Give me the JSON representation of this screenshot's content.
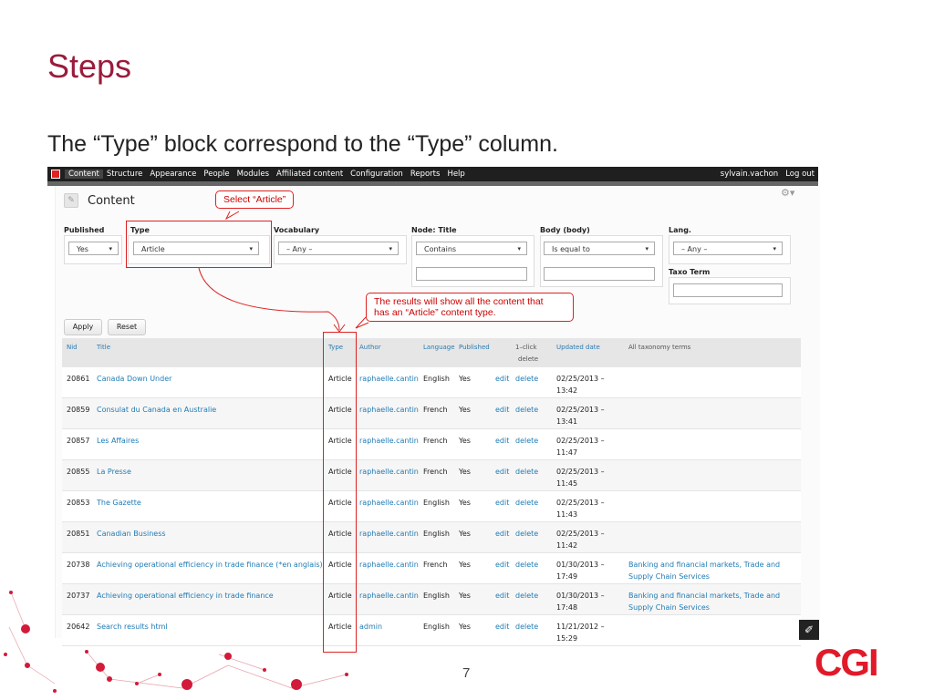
{
  "slide": {
    "title": "Steps",
    "subtitle": "The “Type” block correspond to the “Type” column.",
    "page_number": "7",
    "logo": "CGI"
  },
  "toolbar": {
    "items": [
      "Content",
      "Structure",
      "Appearance",
      "People",
      "Modules",
      "Affiliated content",
      "Configuration",
      "Reports",
      "Help"
    ],
    "user": "sylvain.vachon",
    "logout": "Log out"
  },
  "page": {
    "title": "Content",
    "gear": "⚙▾"
  },
  "callouts": {
    "select_article": "Select “Article”",
    "results_line1": "The results will show all the content that",
    "results_line2": "has an “Article” content type."
  },
  "filters": {
    "published": {
      "label": "Published",
      "value": "Yes"
    },
    "type": {
      "label": "Type",
      "value": "Article"
    },
    "vocabulary": {
      "label": "Vocabulary",
      "value": "– Any –"
    },
    "node_title": {
      "label": "Node: Title",
      "value": "Contains"
    },
    "body": {
      "label": "Body (body)",
      "value": "Is equal to"
    },
    "lang": {
      "label": "Lang.",
      "value": "– Any –"
    },
    "taxo_term": {
      "label": "Taxo Term"
    }
  },
  "buttons": {
    "apply": "Apply",
    "reset": "Reset"
  },
  "table": {
    "headers": {
      "nid": "Nid",
      "title": "Title",
      "type": "Type",
      "author": "Author",
      "language": "Language",
      "published": "Published",
      "one_click_1": "1–click",
      "one_click_2": "delete",
      "updated": "Updated date",
      "taxonomy": "All taxonomy terms"
    },
    "rows": [
      {
        "nid": "20861",
        "title": "Canada Down Under",
        "type": "Article",
        "author": "raphaelle.cantin",
        "language": "English",
        "published": "Yes",
        "edit": "edit",
        "delete": "delete",
        "date": "02/25/2013 –",
        "time": "13:42",
        "tax1": "",
        "tax2": ""
      },
      {
        "nid": "20859",
        "title": "Consulat du Canada en Australie",
        "type": "Article",
        "author": "raphaelle.cantin",
        "language": "French",
        "published": "Yes",
        "edit": "edit",
        "delete": "delete",
        "date": "02/25/2013 –",
        "time": "13:41",
        "tax1": "",
        "tax2": ""
      },
      {
        "nid": "20857",
        "title": "Les Affaires",
        "type": "Article",
        "author": "raphaelle.cantin",
        "language": "French",
        "published": "Yes",
        "edit": "edit",
        "delete": "delete",
        "date": "02/25/2013 –",
        "time": "11:47",
        "tax1": "",
        "tax2": ""
      },
      {
        "nid": "20855",
        "title": "La Presse",
        "type": "Article",
        "author": "raphaelle.cantin",
        "language": "French",
        "published": "Yes",
        "edit": "edit",
        "delete": "delete",
        "date": "02/25/2013 –",
        "time": "11:45",
        "tax1": "",
        "tax2": ""
      },
      {
        "nid": "20853",
        "title": "The Gazette",
        "type": "Article",
        "author": "raphaelle.cantin",
        "language": "English",
        "published": "Yes",
        "edit": "edit",
        "delete": "delete",
        "date": "02/25/2013 –",
        "time": "11:43",
        "tax1": "",
        "tax2": ""
      },
      {
        "nid": "20851",
        "title": "Canadian Business",
        "type": "Article",
        "author": "raphaelle.cantin",
        "language": "English",
        "published": "Yes",
        "edit": "edit",
        "delete": "delete",
        "date": "02/25/2013 –",
        "time": "11:42",
        "tax1": "",
        "tax2": ""
      },
      {
        "nid": "20738",
        "title": "Achieving operational efficiency in trade finance (*en anglais)",
        "type": "Article",
        "author": "raphaelle.cantin",
        "language": "French",
        "published": "Yes",
        "edit": "edit",
        "delete": "delete",
        "date": "01/30/2013 –",
        "time": "17:49",
        "tax1": "Banking and financial markets, Trade and",
        "tax2": "Supply Chain Services"
      },
      {
        "nid": "20737",
        "title": "Achieving operational efficiency in trade finance",
        "type": "Article",
        "author": "raphaelle.cantin",
        "language": "English",
        "published": "Yes",
        "edit": "edit",
        "delete": "delete",
        "date": "01/30/2013 –",
        "time": "17:48",
        "tax1": "Banking and financial markets, Trade and",
        "tax2": "Supply Chain Services"
      },
      {
        "nid": "20642",
        "title": "Search results html",
        "type": "Article",
        "author": "admin",
        "language": "English",
        "published": "Yes",
        "edit": "edit",
        "delete": "delete",
        "date": "11/21/2012 –",
        "time": "15:29",
        "tax1": "",
        "tax2": ""
      }
    ]
  },
  "colors": {
    "accent": "#9b1b3c",
    "callout": "#dd2222",
    "link": "#1f7bb5",
    "logo": "#e11a2a"
  }
}
